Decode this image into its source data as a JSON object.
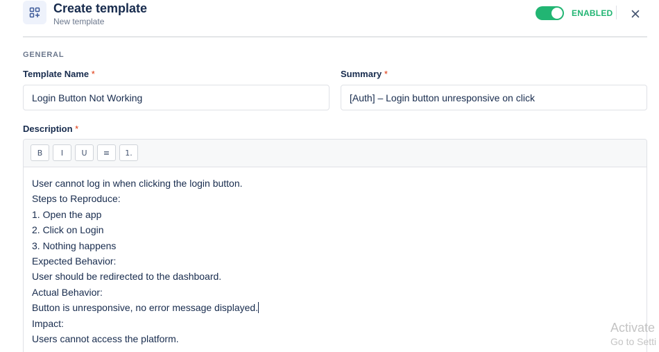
{
  "header": {
    "title": "Create template",
    "subtitle": "New template",
    "status_label": "ENABLED",
    "enabled": true
  },
  "general": {
    "section_label": "GENERAL",
    "template_name": {
      "label": "Template Name",
      "required_mark": "*",
      "value": "Login Button Not Working"
    },
    "summary": {
      "label": "Summary",
      "required_mark": "*",
      "value": "[Auth] – Login button unresponsive on click"
    }
  },
  "description": {
    "label": "Description",
    "required_mark": "*",
    "toolbar": [
      {
        "name": "bold-button",
        "label": "B"
      },
      {
        "name": "italic-button",
        "label": "I"
      },
      {
        "name": "underline-button",
        "label": "U"
      },
      {
        "name": "bullet-list-button",
        "label": "≡"
      },
      {
        "name": "numbered-list-button",
        "label": "1."
      }
    ],
    "lines": [
      "User cannot log in when clicking the login button.",
      "Steps to Reproduce:",
      "1. Open the app",
      "2. Click on Login",
      "3. Nothing happens",
      "Expected Behavior:",
      "User should be redirected to the dashboard.",
      "Actual Behavior:",
      "Button is unresponsive, no error message displayed.",
      "Impact:",
      "Users cannot access the platform."
    ]
  },
  "watermark": {
    "line1": "Activate",
    "line2": "Go to Setti"
  },
  "colors": {
    "accent_green": "#22b573",
    "required_red": "#de350b",
    "text_dark": "#172b4d",
    "text_muted": "#6b778c",
    "border": "#dfe1e6"
  }
}
